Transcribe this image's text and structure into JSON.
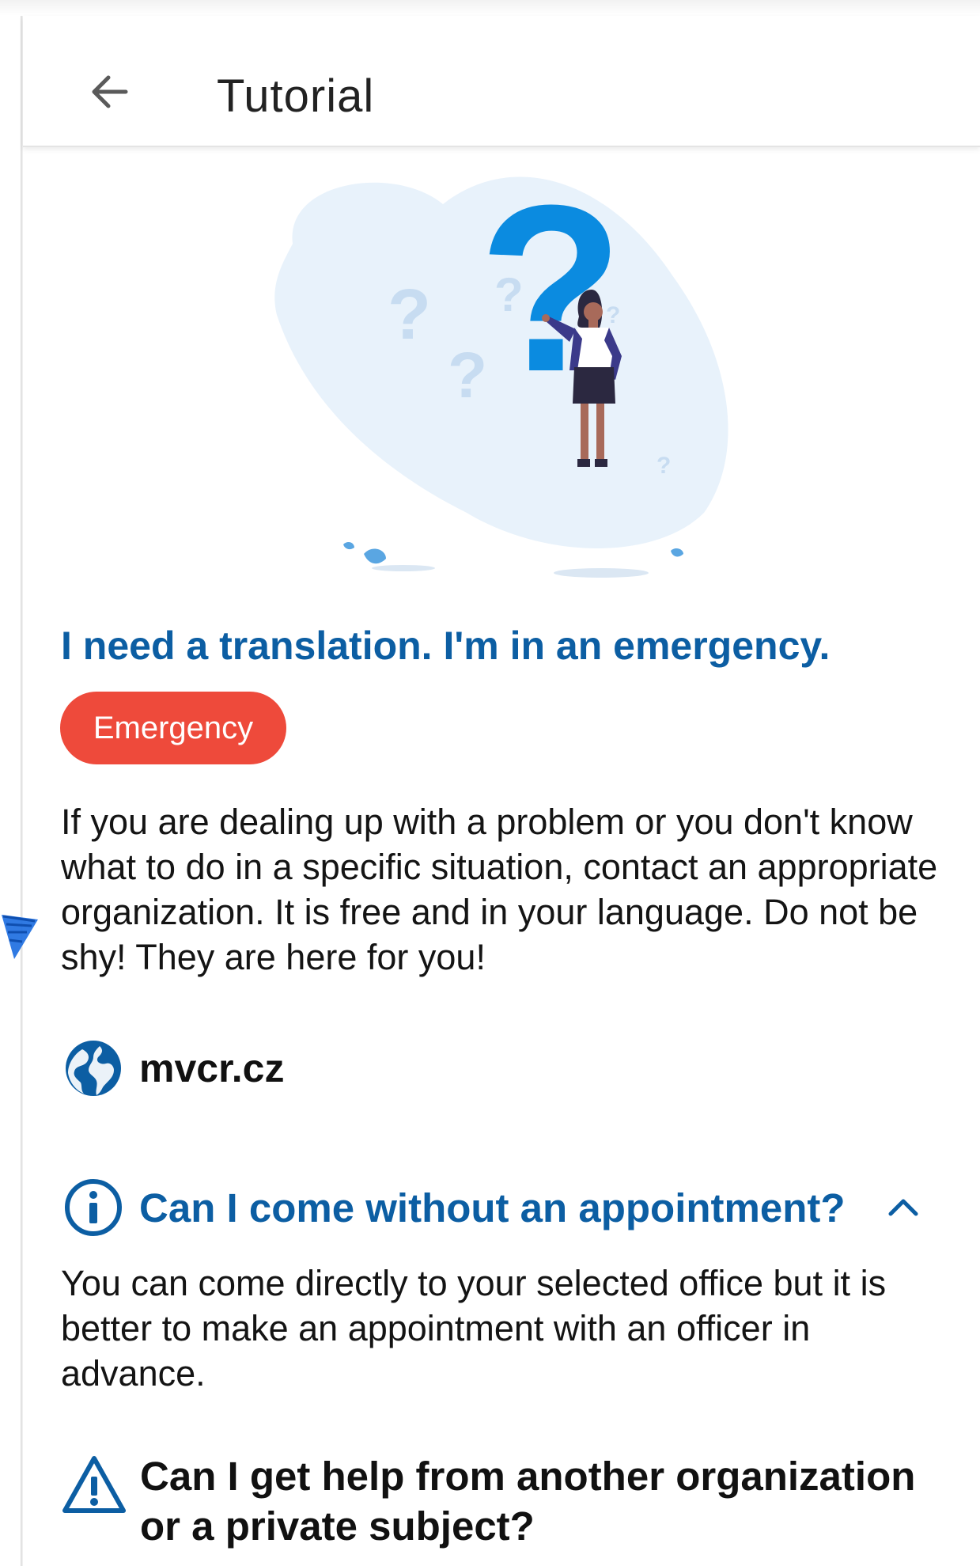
{
  "appbar": {
    "title": "Tutorial",
    "back_icon": "arrow-back-icon"
  },
  "illustration": {
    "name": "question-mark-person-illustration",
    "marks": [
      "?",
      "?",
      "?",
      "?",
      "?",
      "?"
    ]
  },
  "content": {
    "heading": "I need a translation. I'm in an emergency.",
    "badge": "Emergency",
    "paragraph": "If you are dealing up with a problem or you don't know what to do in a specific situation, contact an appropriate organization. It is free and in your language. Do not be shy! They are here for you!",
    "link": {
      "icon": "globe-icon",
      "text": "mvcr.cz"
    },
    "faq": {
      "icon": "info-icon",
      "question": "Can I come without an appointment?",
      "expanded_icon": "chevron-up-icon",
      "answer": "You can come directly to your selected office but it is better to make an appointment with an officer in advance."
    },
    "warning": {
      "icon": "warning-icon",
      "text": "Can I get help from another organization or a private subject?"
    }
  },
  "colors": {
    "primary_blue": "#0c5ea3",
    "emergency_red": "#ee4a3b",
    "question_blue": "#0b8be0",
    "blob": "#e8f2fb"
  }
}
